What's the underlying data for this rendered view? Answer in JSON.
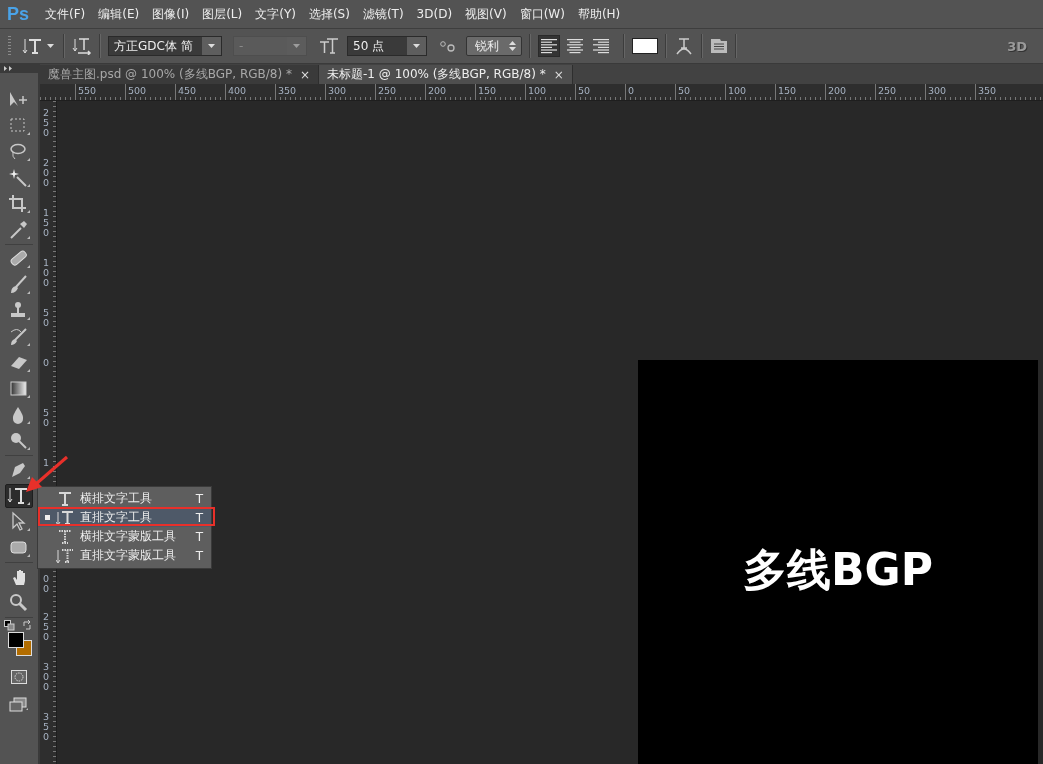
{
  "app": {
    "logo": "Ps"
  },
  "menu": [
    "文件(F)",
    "编辑(E)",
    "图像(I)",
    "图层(L)",
    "文字(Y)",
    "选择(S)",
    "滤镜(T)",
    "3D(D)",
    "视图(V)",
    "窗口(W)",
    "帮助(H)"
  ],
  "options_bar": {
    "font_family": "方正GDC体 简",
    "font_style": {
      "value": "-",
      "disabled": true
    },
    "font_size": "50 点",
    "anti_alias": "锐利",
    "align": [
      {
        "kind": "left",
        "selected": true
      },
      {
        "kind": "center",
        "selected": false
      },
      {
        "kind": "right",
        "selected": false
      }
    ],
    "mode_label": "3D"
  },
  "tabs": [
    {
      "title": "魔兽主图.psd @ 100% (多线BGP, RGB/8) *",
      "close": "×",
      "selected": false
    },
    {
      "title": "未标题-1 @ 100% (多线BGP, RGB/8) *",
      "close": "×",
      "selected": true
    }
  ],
  "ruler_h": [
    "550",
    "500",
    "450",
    "400",
    "350",
    "300",
    "250",
    "200",
    "150",
    "100",
    "50",
    "0",
    "50",
    "100",
    "150",
    "200",
    "250",
    "300",
    "350"
  ],
  "ruler_v": {
    "upper": [
      "250",
      "200",
      "150",
      "100",
      "50",
      "0",
      "50",
      "1"
    ],
    "lower": [
      "00",
      "250",
      "300",
      "350"
    ]
  },
  "tool_groups": [
    [
      {
        "kind": "move",
        "selected": false
      },
      {
        "kind": "marquee",
        "selected": false
      },
      {
        "kind": "lasso",
        "selected": false
      },
      {
        "kind": "wand",
        "selected": false
      },
      {
        "kind": "crop",
        "selected": false
      },
      {
        "kind": "eyedropper",
        "selected": false
      }
    ],
    [
      {
        "kind": "bandage",
        "selected": false
      },
      {
        "kind": "brush",
        "selected": false
      },
      {
        "kind": "stamp",
        "selected": false
      },
      {
        "kind": "history",
        "selected": false
      },
      {
        "kind": "eraser",
        "selected": false
      },
      {
        "kind": "gradient",
        "selected": false
      },
      {
        "kind": "drop",
        "selected": false
      },
      {
        "kind": "dodge",
        "selected": false
      }
    ],
    [
      {
        "kind": "pen",
        "selected": false
      },
      {
        "kind": "vtype",
        "selected": true
      },
      {
        "kind": "select",
        "selected": false
      },
      {
        "kind": "shape",
        "selected": false
      }
    ],
    [
      {
        "kind": "hand",
        "selected": false
      },
      {
        "kind": "zoom",
        "selected": false
      }
    ]
  ],
  "document": {
    "text": "多线BGP"
  },
  "flyout": {
    "items": [
      {
        "kind": "htype",
        "label": "横排文字工具",
        "shortcut": "T",
        "current": false,
        "selected": false,
        "annotated": false
      },
      {
        "kind": "vtype",
        "label": "直排文字工具",
        "shortcut": "T",
        "current": true,
        "selected": true,
        "annotated": true
      },
      {
        "kind": "hmask",
        "label": "横排文字蒙版工具",
        "shortcut": "T",
        "current": false,
        "selected": false,
        "annotated": false
      },
      {
        "kind": "vmask",
        "label": "直排文字蒙版工具",
        "shortcut": "T",
        "current": false,
        "selected": false,
        "annotated": false
      }
    ]
  },
  "annotation_arrow": true
}
